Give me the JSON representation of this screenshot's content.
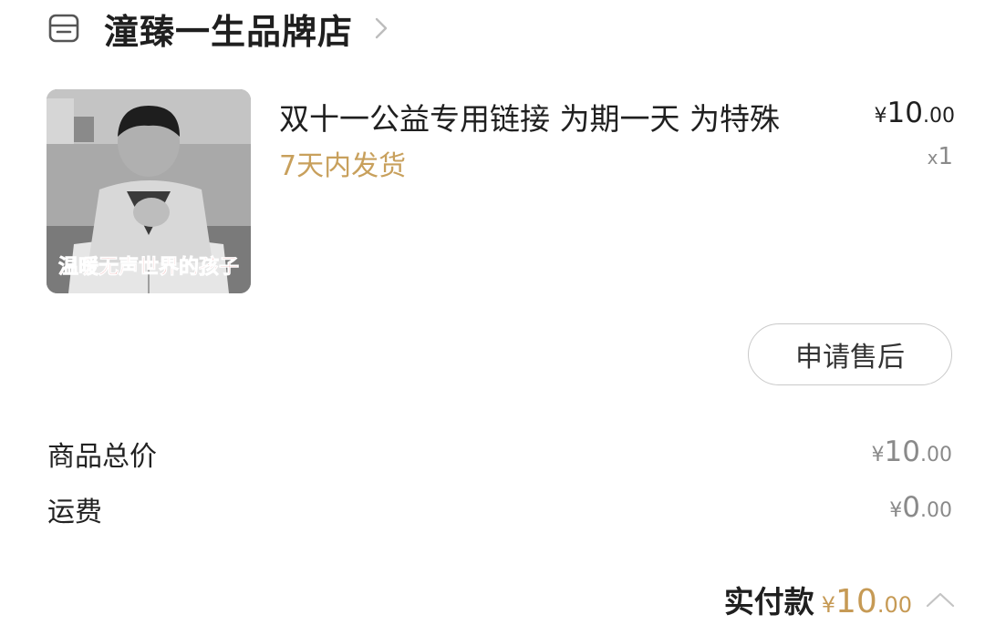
{
  "store": {
    "name": "潼臻一生品牌店",
    "icon": "store-icon",
    "chevron": "chevron-right-icon"
  },
  "product": {
    "title": "双十一公益专用链接 为期一天 为特殊",
    "shipping_note": "7天内发货",
    "image_caption": "温暖无声世界的孩子",
    "price_currency": "¥",
    "price_integer": "10",
    "price_decimal": ".00",
    "qty_prefix": "x",
    "qty_value": "1"
  },
  "actions": {
    "after_sale_label": "申请售后"
  },
  "summary": {
    "goods_total_label": "商品总价",
    "goods_total_currency": "¥",
    "goods_total_integer": "10",
    "goods_total_decimal": ".00",
    "shipping_label": "运费",
    "shipping_currency": "¥",
    "shipping_integer": "0",
    "shipping_decimal": ".00"
  },
  "total": {
    "label": "实付款",
    "currency": "¥",
    "integer": "10",
    "decimal": ".00",
    "color": "#c69a55"
  },
  "colors": {
    "accent_gold": "#c8a05c",
    "text_primary": "#1f1f1f",
    "text_muted": "#8a8a8a"
  }
}
